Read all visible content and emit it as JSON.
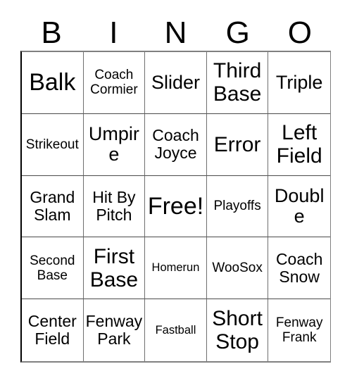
{
  "card": {
    "title": "Bingo Card",
    "header_letters": [
      "B",
      "I",
      "N",
      "G",
      "O"
    ],
    "columns": 5,
    "rows": 5,
    "free_space_label": "Free!",
    "free_space_position": {
      "row": 3,
      "column": 3
    },
    "border_color": "#000000",
    "background_color": "#ffffff",
    "text_color": "#000000"
  },
  "grid": {
    "rows": [
      {
        "cells": [
          {
            "label": "Balk",
            "size": "xxl"
          },
          {
            "label": "Coach Cormier",
            "size": "sm"
          },
          {
            "label": "Slider",
            "size": "lg"
          },
          {
            "label": "Third Base",
            "size": "xl"
          },
          {
            "label": "Triple",
            "size": "lg"
          }
        ]
      },
      {
        "cells": [
          {
            "label": "Strikeout",
            "size": "sm"
          },
          {
            "label": "Umpire",
            "size": "lg"
          },
          {
            "label": "Coach Joyce",
            "size": "md"
          },
          {
            "label": "Error",
            "size": "xl"
          },
          {
            "label": "Left Field",
            "size": "xl"
          }
        ]
      },
      {
        "cells": [
          {
            "label": "Grand Slam",
            "size": "md"
          },
          {
            "label": "Hit By Pitch",
            "size": "md"
          },
          {
            "label": "Free!",
            "size": "xxl"
          },
          {
            "label": "Playoffs",
            "size": "sm"
          },
          {
            "label": "Double",
            "size": "lg"
          }
        ]
      },
      {
        "cells": [
          {
            "label": "Second Base",
            "size": "sm"
          },
          {
            "label": "First Base",
            "size": "xl"
          },
          {
            "label": "Homerun",
            "size": "xs"
          },
          {
            "label": "WooSox",
            "size": "sm"
          },
          {
            "label": "Coach Snow",
            "size": "md"
          }
        ]
      },
      {
        "cells": [
          {
            "label": "Center Field",
            "size": "md"
          },
          {
            "label": "Fenway Park",
            "size": "md"
          },
          {
            "label": "Fastball",
            "size": "xs"
          },
          {
            "label": "Short Stop",
            "size": "xl"
          },
          {
            "label": "Fenway Frank",
            "size": "sm"
          }
        ]
      }
    ]
  }
}
